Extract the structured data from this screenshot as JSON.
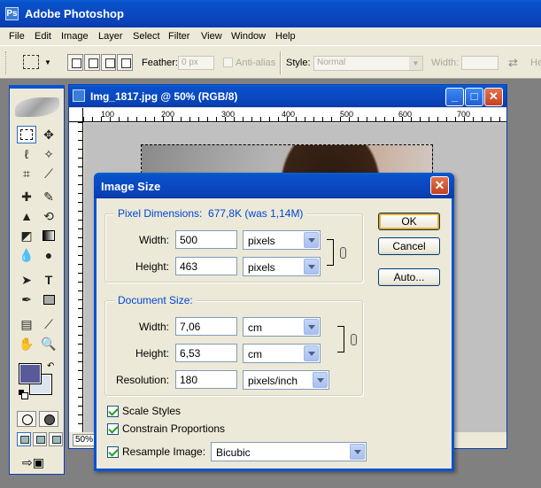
{
  "app": {
    "title": "Adobe Photoshop",
    "icon": "photoshop-icon"
  },
  "menu": [
    "File",
    "Edit",
    "Image",
    "Layer",
    "Select",
    "Filter",
    "View",
    "Window",
    "Help"
  ],
  "options": {
    "feather_label": "Feather:",
    "feather_value": "0 px",
    "antialias_label": "Anti-alias",
    "style_label": "Style:",
    "style_value": "Normal",
    "width_label": "Width:",
    "height_label_partial": "He"
  },
  "document": {
    "title": "Img_1817.jpg @ 50% (RGB/8)",
    "zoom_status": "50%",
    "ruler_labels": [
      "100",
      "200",
      "300",
      "400",
      "500",
      "600",
      "700"
    ]
  },
  "toolbox": {
    "foreground_color": "#5a5a9a",
    "background_color": "#dce4ee"
  },
  "dialog": {
    "title": "Image Size",
    "pixel_dimensions": {
      "label": "Pixel Dimensions:",
      "summary": "677,8K (was 1,14M)",
      "width_label": "Width:",
      "width_value": "500",
      "width_unit": "pixels",
      "height_label": "Height:",
      "height_value": "463",
      "height_unit": "pixels"
    },
    "document_size": {
      "label": "Document Size:",
      "width_label": "Width:",
      "width_value": "7,06",
      "width_unit": "cm",
      "height_label": "Height:",
      "height_value": "6,53",
      "height_unit": "cm",
      "resolution_label": "Resolution:",
      "resolution_value": "180",
      "resolution_unit": "pixels/inch"
    },
    "scale_styles": "Scale Styles",
    "constrain_proportions": "Constrain Proportions",
    "resample_image": "Resample Image:",
    "resample_method": "Bicubic",
    "buttons": {
      "ok": "OK",
      "cancel": "Cancel",
      "auto": "Auto..."
    }
  }
}
